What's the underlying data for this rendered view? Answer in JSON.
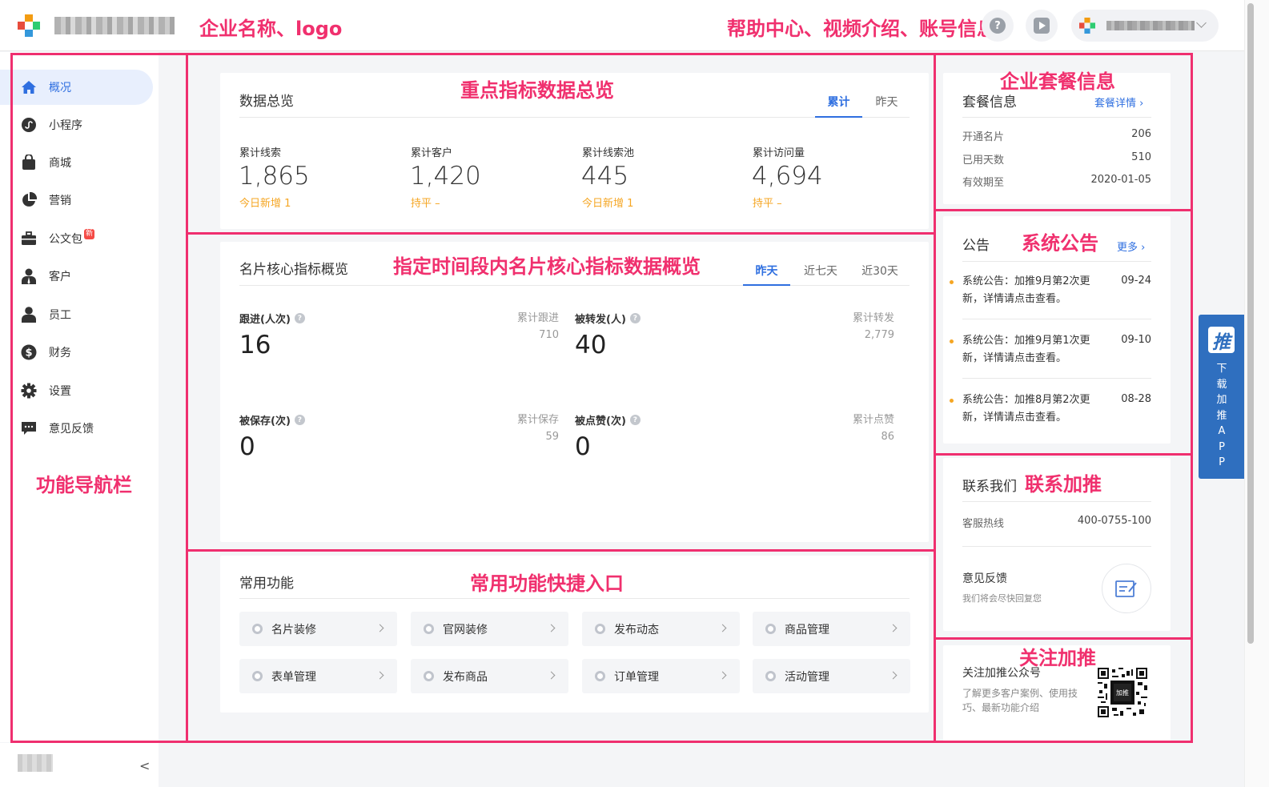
{
  "annotations": {
    "header": "企业名称、logo",
    "top_right": "帮助中心、视频介绍、账号信息",
    "overview": "重点指标数据总览",
    "card_metrics": "指定时间段内名片核心指标数据概览",
    "functions": "常用功能快捷入口",
    "plan": "企业套餐信息",
    "notice": "系统公告",
    "contact": "联系加推",
    "follow": "关注加推",
    "nav": "功能导航栏"
  },
  "header": {
    "help_icon": "help-icon",
    "video_icon": "video-icon",
    "help_glyph": "?"
  },
  "sidebar": {
    "items": [
      {
        "label": "概况",
        "icon": "home-icon",
        "active": true
      },
      {
        "label": "小程序",
        "icon": "mini-program-icon"
      },
      {
        "label": "商城",
        "icon": "shopping-bag-icon"
      },
      {
        "label": "营销",
        "icon": "pie-chart-icon"
      },
      {
        "label": "公文包",
        "icon": "briefcase-icon",
        "badge": "新"
      },
      {
        "label": "客户",
        "icon": "customer-icon"
      },
      {
        "label": "员工",
        "icon": "person-icon"
      },
      {
        "label": "财务",
        "icon": "dollar-icon"
      },
      {
        "label": "设置",
        "icon": "gear-icon"
      },
      {
        "label": "意见反馈",
        "icon": "message-icon"
      }
    ],
    "collapse_glyph": "<"
  },
  "overview": {
    "title": "数据总览",
    "tabs": [
      "累计",
      "昨天"
    ],
    "stats": [
      {
        "label": "累计线索",
        "value": "1,865",
        "trend": "今日新增 1"
      },
      {
        "label": "累计客户",
        "value": "1,420",
        "trend": "持平 –"
      },
      {
        "label": "累计线索池",
        "value": "445",
        "trend": "今日新增 1"
      },
      {
        "label": "累计访问量",
        "value": "4,694",
        "trend": "持平 –"
      }
    ]
  },
  "card_metrics": {
    "title": "名片核心指标概览",
    "tabs": [
      "昨天",
      "近七天",
      "近30天"
    ],
    "metrics": [
      {
        "label": "跟进(人次)",
        "value": "16",
        "side_label": "累计跟进",
        "side_value": "710"
      },
      {
        "label": "被转发(人)",
        "value": "40",
        "side_label": "累计转发",
        "side_value": "2,779"
      },
      {
        "label": "被保存(次)",
        "value": "0",
        "side_label": "累计保存",
        "side_value": "59"
      },
      {
        "label": "被点赞(次)",
        "value": "0",
        "side_label": "累计点赞",
        "side_value": "86"
      }
    ],
    "q_glyph": "?"
  },
  "functions": {
    "title": "常用功能",
    "items": [
      "名片装修",
      "官网装修",
      "发布动态",
      "商品管理",
      "表单管理",
      "发布商品",
      "订单管理",
      "活动管理"
    ]
  },
  "plan": {
    "title": "套餐信息",
    "link": "套餐详情 ›",
    "rows": [
      {
        "k": "开通名片",
        "v": "206"
      },
      {
        "k": "已用天数",
        "v": "510"
      },
      {
        "k": "有效期至",
        "v": "2020-01-05"
      }
    ]
  },
  "notice": {
    "title": "公告",
    "more": "更多 ›",
    "items": [
      {
        "text": "系统公告：加推9月第2次更新，详情请点击查看。",
        "date": "09-24"
      },
      {
        "text": "系统公告：加推9月第1次更新，详情请点击查看。",
        "date": "09-10"
      },
      {
        "text": "系统公告：加推8月第2次更新，详情请点击查看。",
        "date": "08-28"
      }
    ]
  },
  "contact": {
    "title": "联系我们",
    "hotline_label": "客服热线",
    "hotline": "400-0755-100",
    "feedback_title": "意见反馈",
    "feedback_sub": "我们将会尽快回复您"
  },
  "follow": {
    "title": "关注加推公众号",
    "desc": "了解更多客户案例、使用技巧、最新功能介绍"
  },
  "app_download": {
    "logo": "推",
    "text": "下载加推APP"
  },
  "colors": {
    "accent": "#2f6fe0",
    "annotation": "#f0306e",
    "trend": "#f5a623"
  }
}
